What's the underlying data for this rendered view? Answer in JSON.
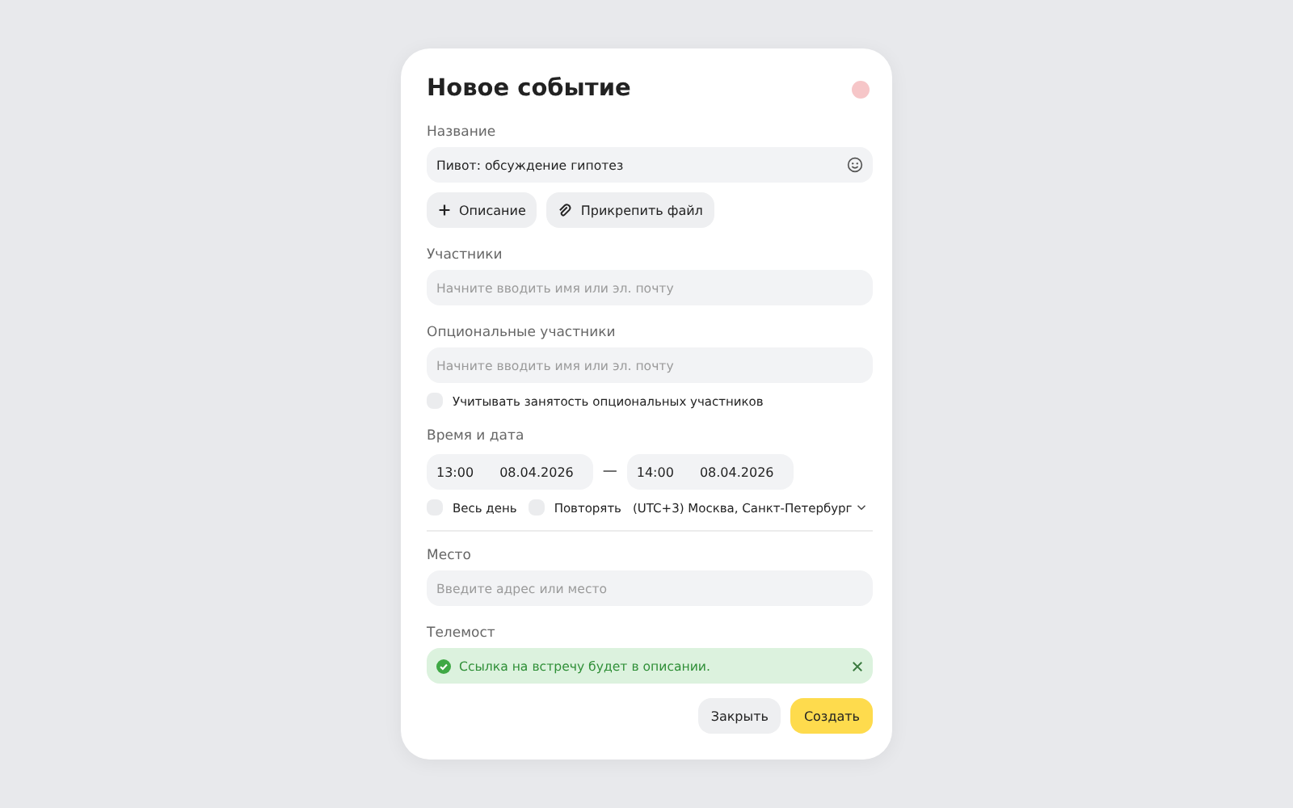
{
  "dialog": {
    "title": "Новое событие"
  },
  "name": {
    "label": "Название",
    "value": "Пивот: обсуждение гипотез"
  },
  "attach_buttons": [
    "Описание",
    "Прикрепить файл"
  ],
  "participants": {
    "label": "Участники",
    "placeholder": "Начните вводить имя или эл. почту"
  },
  "optional_participants": {
    "label": "Опциональные участники",
    "placeholder": "Начните вводить имя или эл. почту"
  },
  "consider_optional": {
    "label": "Учитывать занятость опциональных участников",
    "checked": false
  },
  "time": {
    "label": "Время и дата",
    "start_time": "13:00",
    "start_date": "08.04.2026",
    "dash": "—",
    "end_time": "14:00",
    "end_date": "08.04.2026"
  },
  "all_day": {
    "label": "Весь день",
    "checked": false
  },
  "repeat": {
    "label": "Повторять",
    "checked": false
  },
  "timezone": "(UTC+3) Москва, Санкт-Петербург",
  "place": {
    "label": "Место",
    "placeholder": "Введите адрес или место"
  },
  "telemost": {
    "label": "Телемост",
    "notice": "Ссылка на встречу будет в описании."
  },
  "buttons": [
    {
      "label": "Закрыть",
      "kind": "secondary"
    },
    {
      "label": "Создать",
      "kind": "primary"
    }
  ]
}
